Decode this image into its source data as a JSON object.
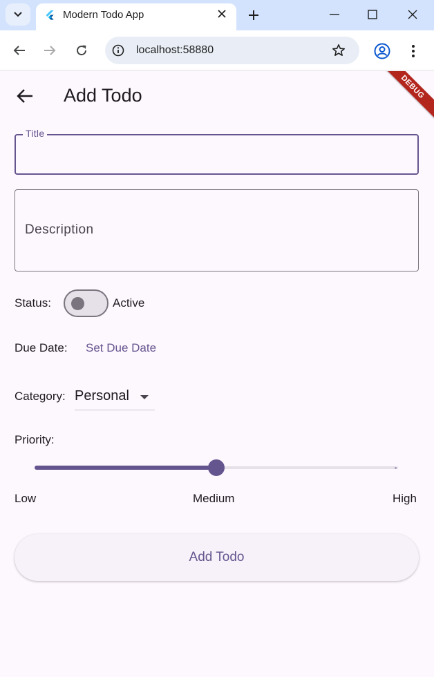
{
  "browser": {
    "tab_title": "Modern Todo App",
    "url": "localhost:58880"
  },
  "app": {
    "debug_banner": "DEBUG",
    "page_title": "Add Todo",
    "form": {
      "title_label": "Title",
      "title_value": "",
      "description_label": "Description",
      "status_label": "Status:",
      "status_value": "Active",
      "status_on": false,
      "due_date_label": "Due Date:",
      "due_date_button": "Set Due Date",
      "category_label": "Category:",
      "category_value": "Personal",
      "priority_label": "Priority:",
      "priority": {
        "value": 0.5,
        "ticks": [
          "Low",
          "Medium",
          "High"
        ]
      },
      "submit_label": "Add Todo"
    }
  },
  "colors": {
    "primary": "#65558f",
    "background": "#fdf7fe",
    "debug_banner": "#b3261e"
  }
}
